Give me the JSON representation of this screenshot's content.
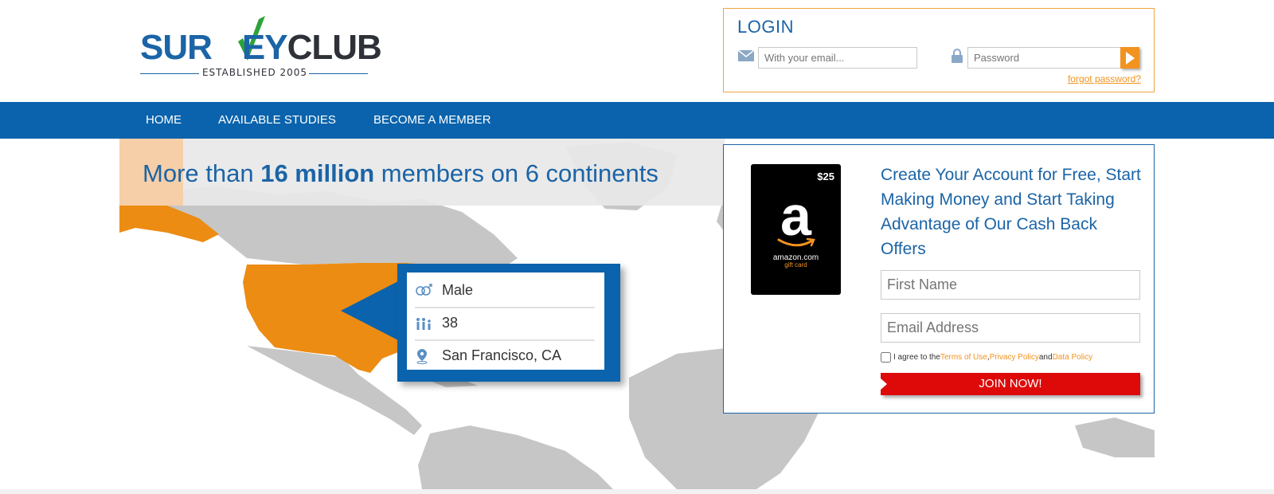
{
  "logo": {
    "part1": "SUR",
    "part2": "EY",
    "part3": "CLUB",
    "established": "ESTABLISHED 2005"
  },
  "login": {
    "title": "LOGIN",
    "email_placeholder": "With your email...",
    "password_placeholder": "Password",
    "forgot": "forgot password?"
  },
  "nav": {
    "items": [
      {
        "label": "HOME"
      },
      {
        "label": "AVAILABLE STUDIES"
      },
      {
        "label": "BECOME A MEMBER"
      }
    ]
  },
  "hero": {
    "headline_pre": "More than ",
    "headline_bold": "16 million",
    "headline_post": " members on 6 continents",
    "profile": {
      "gender": "Male",
      "age": "38",
      "location": "San Francisco, CA"
    }
  },
  "signup": {
    "giftcard_amount": "$25",
    "giftcard_letter": "a",
    "giftcard_brand": "amazon.com",
    "giftcard_sub": "gift card",
    "heading": "Create Your Account for Free, Start Making Money and Start Taking Advantage of Our Cash Back Offers",
    "first_name_placeholder": "First Name",
    "email_placeholder": "Email Address",
    "agree_prefix": "I agree to the ",
    "terms": "Terms of Use",
    "comma": ", ",
    "privacy": "Privacy Policy",
    "and": " and ",
    "data_policy": "Data Policy",
    "join": "JOIN NOW!"
  },
  "colors": {
    "brand_blue": "#0a63ac",
    "accent_orange": "#f29320",
    "map_orange": "#ec8c13",
    "map_gray": "#c8c8c8",
    "join_red": "#de0a0a"
  },
  "icons": [
    "envelope-icon",
    "lock-icon",
    "arrow-right-icon",
    "gender-icon",
    "age-icon",
    "location-pin-icon",
    "amazon-smile-icon"
  ]
}
